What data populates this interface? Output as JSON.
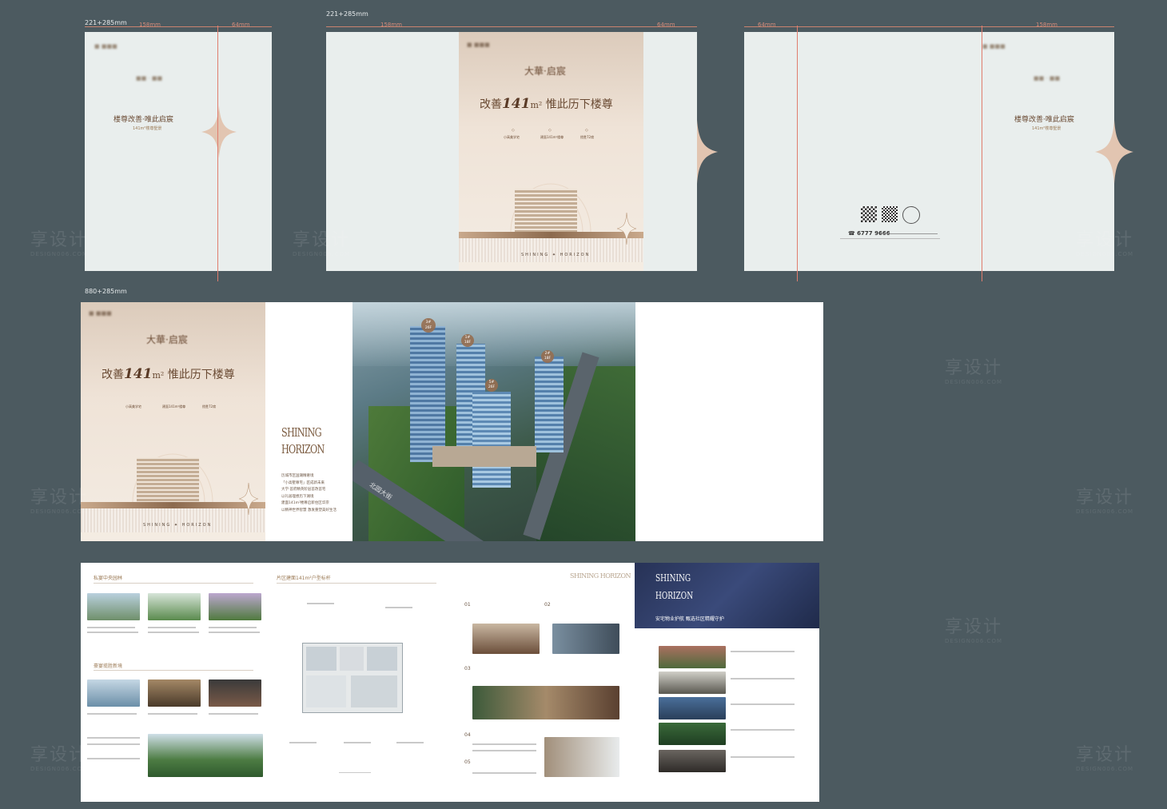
{
  "labels": {
    "size_a": "221+285mm",
    "size_b": "221+285mm",
    "size_c": "880+285mm",
    "mm_158": "158mm",
    "mm_64": "64mm"
  },
  "cover": {
    "brand": "大華·启宸",
    "headline_left": "改善",
    "area": "141",
    "unit": "m²",
    "headline_right": "惟此历下楼尊",
    "slogan": "楼尊改善·唯此启宸",
    "sub_slogan": "141m²楼尊墅景",
    "features": [
      "小高美学宅",
      "建面141m²楼尊",
      "揽胜72席"
    ],
    "footer_en": "SHINING ✦ HORIZON",
    "phone": "6777 9666"
  },
  "spread": {
    "title_en_1": "SHINING",
    "title_en_2": "HORIZON",
    "body_lines": [
      "历城市区国潮精奢境",
      "「小高墅尊宅」匠成新未来",
      "大学·首府精英阶层首改首宅",
      "以礼居理想历下湖境",
      "建面141m²楼尊启新住区华宗",
      "以精神世界智慧 激发重塑美好生活"
    ],
    "tags": [
      {
        "line1": "3#",
        "line2": "26F"
      },
      {
        "line1": "1#",
        "line2": "18F"
      },
      {
        "line1": "2#",
        "line2": "18F"
      },
      {
        "line1": "5#",
        "line2": "26F"
      }
    ],
    "road": "北园大街"
  },
  "inner": {
    "p1_title": "私宴中央园林",
    "p1_title2": "豪宴揽胜新境",
    "p2_title": "片区建面141m²户型标杆",
    "p3_title": "SHINING HORIZON",
    "p4_title_en_1": "SHINING",
    "p4_title_en_2": "HORIZON",
    "p4_subtitle": "安宅物业护航 甄选社区精耀守护",
    "numbers": [
      "01",
      "02",
      "03",
      "04",
      "05"
    ]
  },
  "watermark": {
    "cn": "享设计",
    "en": "DESIGN006.COM"
  },
  "colors": {
    "bg": "#4c5a60",
    "accent": "#e07d6e",
    "gold": "#9b7a55",
    "rose": "#e0c2ac"
  }
}
